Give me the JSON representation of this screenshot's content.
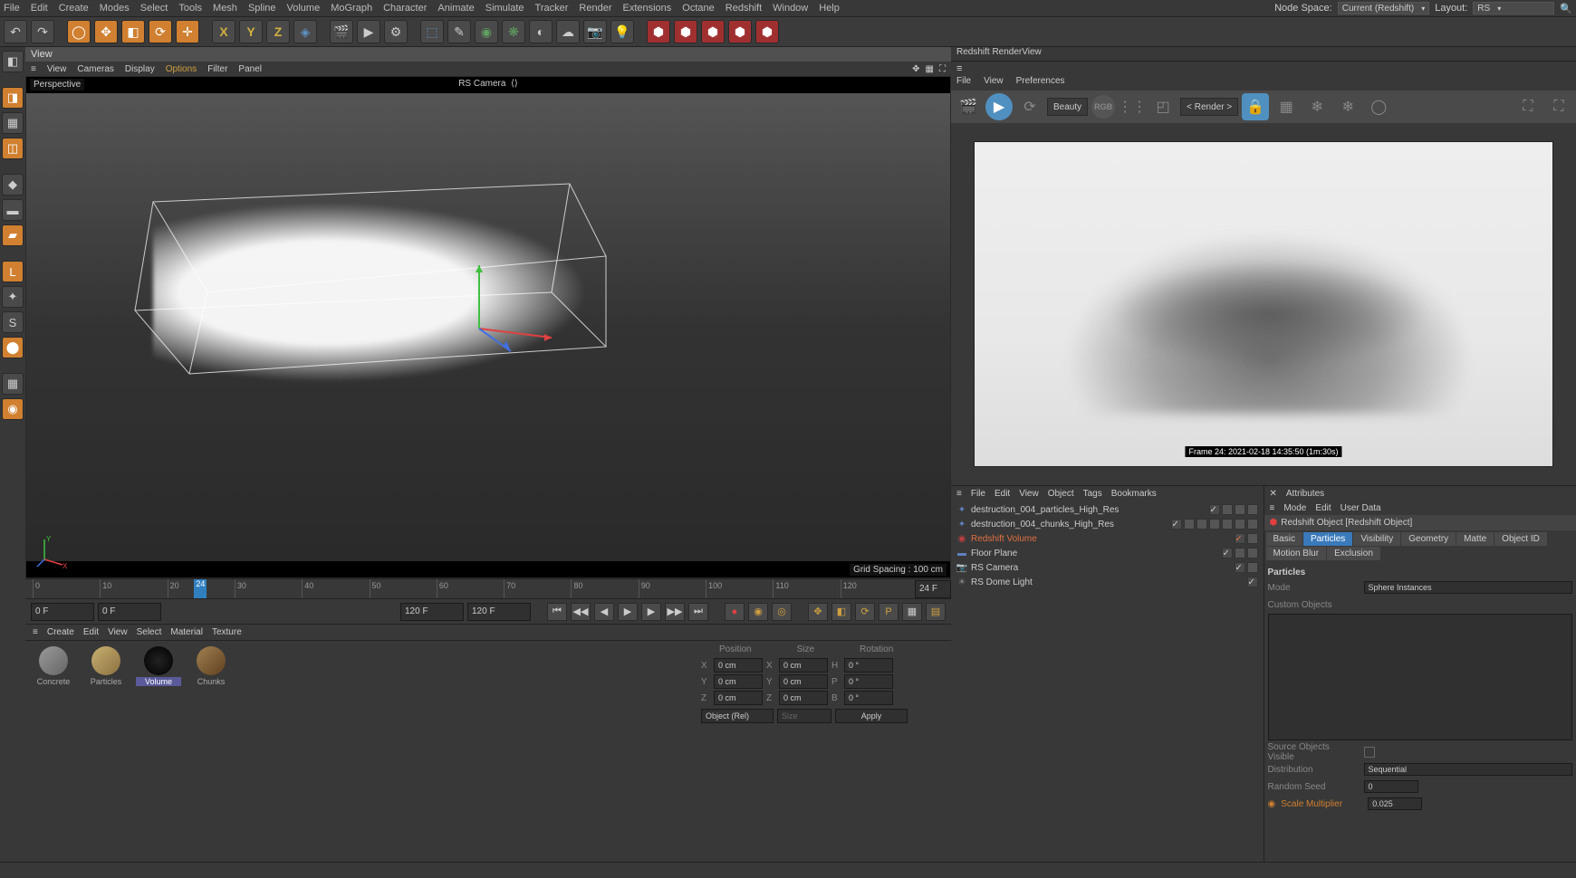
{
  "menu": [
    "File",
    "Edit",
    "Create",
    "Modes",
    "Select",
    "Tools",
    "Mesh",
    "Spline",
    "Volume",
    "MoGraph",
    "Character",
    "Animate",
    "Simulate",
    "Tracker",
    "Render",
    "Extensions",
    "Octane",
    "Redshift",
    "Window",
    "Help"
  ],
  "top_right": {
    "node_space_label": "Node Space:",
    "node_space_value": "Current (Redshift)",
    "layout_label": "Layout:",
    "layout_value": "RS"
  },
  "view_header": "View",
  "view_menu": [
    "View",
    "Cameras",
    "Display",
    "Options",
    "Filter",
    "Panel"
  ],
  "view_menu_active_index": 3,
  "persp_label": "Perspective",
  "rs_cam_label": "RS Camera",
  "grid_label": "Grid Spacing : 100 cm",
  "timeline": {
    "ticks": [
      0,
      10,
      20,
      30,
      40,
      50,
      60,
      70,
      80,
      90,
      100,
      110,
      120
    ],
    "current": 24,
    "field": "24 F"
  },
  "playback": {
    "start": "0 F",
    "loop_start": "0 F",
    "loop_end": "120 F",
    "end": "120 F"
  },
  "mat_menu": [
    "Create",
    "Edit",
    "View",
    "Select",
    "Material",
    "Texture"
  ],
  "materials": [
    {
      "name": "Concrete",
      "color": "linear-gradient(135deg,#999,#666)"
    },
    {
      "name": "Particles",
      "color": "linear-gradient(135deg,#c9b070,#8a7040)"
    },
    {
      "name": "Volume",
      "color": "radial-gradient(circle,#222,#000)",
      "sel": true
    },
    {
      "name": "Chunks",
      "color": "linear-gradient(135deg,#a08050,#604020)"
    }
  ],
  "psr": {
    "heads": [
      "Position",
      "Size",
      "Rotation"
    ],
    "rows": [
      {
        "a": "X",
        "av": "0 cm",
        "b": "X",
        "bv": "0 cm",
        "c": "H",
        "cv": "0 °"
      },
      {
        "a": "Y",
        "av": "0 cm",
        "b": "Y",
        "bv": "0 cm",
        "c": "P",
        "cv": "0 °"
      },
      {
        "a": "Z",
        "av": "0 cm",
        "b": "Z",
        "bv": "0 cm",
        "c": "B",
        "cv": "0 °"
      }
    ],
    "mode": "Object (Rel)",
    "size_btn": "Size",
    "apply": "Apply"
  },
  "rv": {
    "title": "Redshift RenderView",
    "menu": [
      "File",
      "View",
      "Preferences"
    ],
    "aov": "Beauty",
    "rgb": "RGB",
    "render_select": "< Render >",
    "frame_label": "Frame  24:  2021-02-18  14:35:50  (1m:30s)"
  },
  "obj_menu": [
    "File",
    "Edit",
    "View",
    "Object",
    "Tags",
    "Bookmarks"
  ],
  "objects": [
    {
      "icon": "✦",
      "color": "#6080c0",
      "name": "destruction_004_particles_High_Res",
      "tags": 3
    },
    {
      "icon": "✦",
      "color": "#6080c0",
      "name": "destruction_004_chunks_High_Res",
      "tags": 6
    },
    {
      "icon": "◉",
      "color": "#c04040",
      "name": "Redshift Volume",
      "sel": true,
      "tags": 1
    },
    {
      "icon": "▬",
      "color": "#6080c0",
      "name": "Floor Plane",
      "tags": 2
    },
    {
      "icon": "📷",
      "color": "#888",
      "name": "RS Camera",
      "tags": 1
    },
    {
      "icon": "☀",
      "color": "#888",
      "name": "RS Dome Light",
      "tags": 0
    }
  ],
  "attr": {
    "header": "Attributes",
    "menu": [
      "Mode",
      "Edit",
      "User Data"
    ],
    "title": "Redshift Object [Redshift Object]",
    "tabs": [
      "Basic",
      "Particles",
      "Visibility",
      "Geometry",
      "Matte",
      "Object ID",
      "Motion Blur",
      "Exclusion"
    ],
    "active_tab": "Particles",
    "section": "Particles",
    "mode_label": "Mode",
    "mode_value": "Sphere Instances",
    "custom_label": "Custom Objects",
    "src_vis_label": "Source Objects Visible",
    "dist_label": "Distribution",
    "dist_value": "Sequential",
    "seed_label": "Random Seed",
    "seed_value": "0",
    "scale_label": "Scale Multiplier",
    "scale_value": "0.025"
  }
}
